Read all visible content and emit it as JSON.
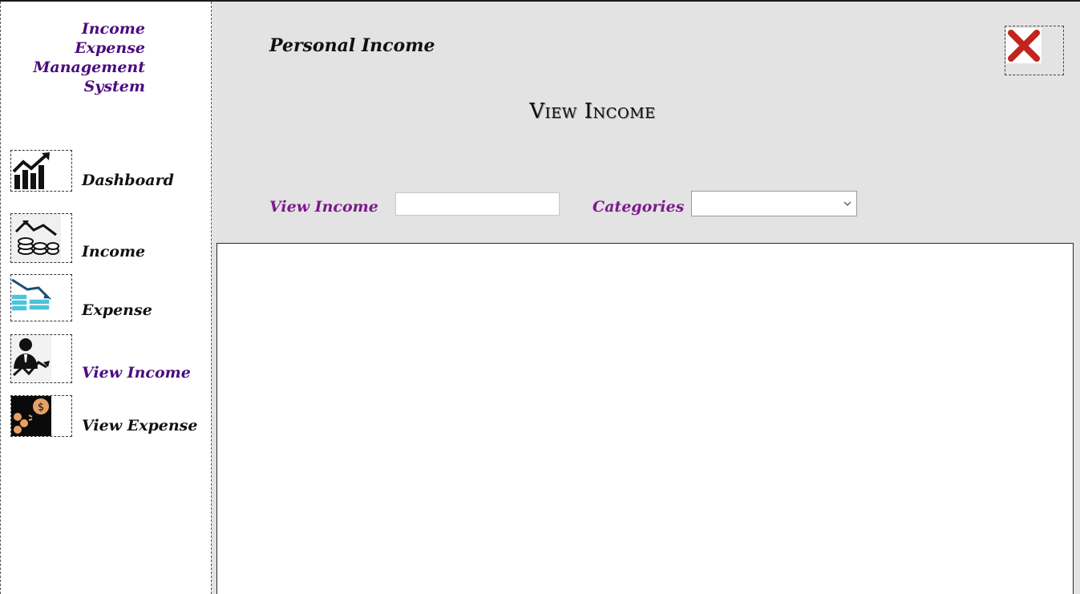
{
  "sidebar": {
    "app_title": "Income Expense\nManagement\nSystem",
    "items": [
      {
        "label": "Dashboard",
        "icon": "chart-growth-icon",
        "active": false
      },
      {
        "label": "Income",
        "icon": "coins-rising-icon",
        "active": false
      },
      {
        "label": "Expense",
        "icon": "coins-falling-icon",
        "active": false
      },
      {
        "label": "View Income",
        "icon": "businessman-growth-icon",
        "active": true
      },
      {
        "label": "View Expense",
        "icon": "money-bag-icon",
        "active": false
      }
    ]
  },
  "main": {
    "title": "Personal Income",
    "heading": "View Income",
    "filters": {
      "view_income_label": "View Income",
      "view_income_value": "",
      "categories_label": "Categories",
      "categories_value": ""
    },
    "close_icon": "close-icon"
  },
  "colors": {
    "brand_purple": "#4b0b7e",
    "label_purple": "#7c1a8c",
    "close_red": "#c0251e",
    "main_bg": "#e3e3e3"
  }
}
